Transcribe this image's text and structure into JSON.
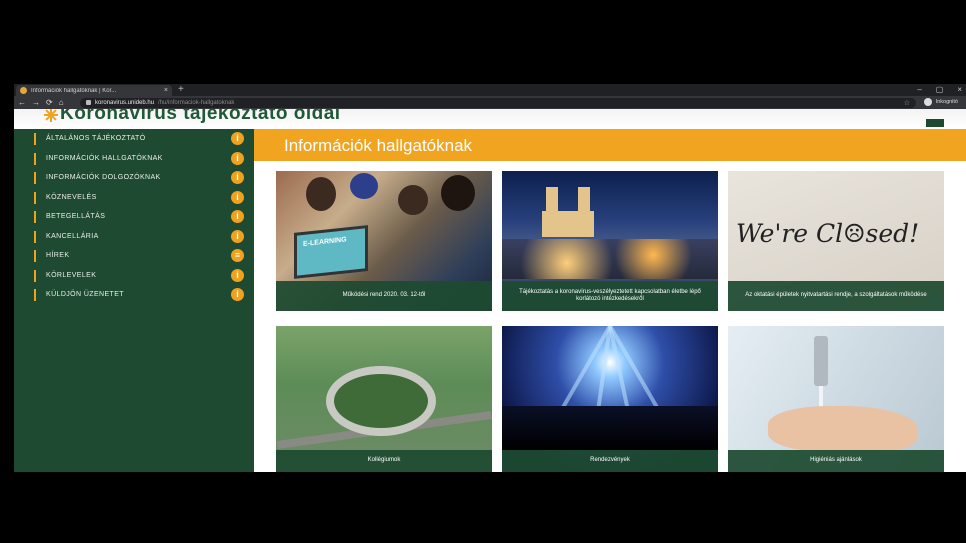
{
  "browser": {
    "tab_title": "Információk hallgatóknak | Kor...",
    "tab_close": "×",
    "new_tab": "+",
    "window_controls": [
      "–",
      "▢",
      "×"
    ],
    "nav_icons": [
      "←",
      "→",
      "⟳",
      "⌂"
    ],
    "url_host": "koronavirus.unideb.hu",
    "url_path": "/hu/informaciok-hallgatoknak",
    "profile_label": "Inkognitó"
  },
  "site": {
    "title": "Koronavírus tájékoztató oldal"
  },
  "sidebar": {
    "items": [
      {
        "label": "Általános tájékoztató",
        "badge": "i"
      },
      {
        "label": "Információk hallgatóknak",
        "badge": "i"
      },
      {
        "label": "Információk dolgozóknak",
        "badge": "i"
      },
      {
        "label": "Köznevelés",
        "badge": "i"
      },
      {
        "label": "Betegellátás",
        "badge": "i"
      },
      {
        "label": "Kancellária",
        "badge": "i"
      },
      {
        "label": "Hírek",
        "badge": "≡"
      },
      {
        "label": "Körlevelek",
        "badge": "i"
      },
      {
        "label": "Küldjön üzenetet",
        "badge": "i"
      }
    ]
  },
  "main": {
    "heading": "Információk hallgatóknak",
    "cards": [
      {
        "caption": "Működési rend 2020. 03. 12-től"
      },
      {
        "caption": "Tájékoztatás a koronavírus-veszélyeztetett kapcsolatban életbe lépő korlátozó intézkedésekről"
      },
      {
        "caption": "Az oktatási épületek nyitvatartási rendje, a szolgáltatások működése"
      },
      {
        "caption": "Kollégiumok"
      },
      {
        "caption": "Rendezvények"
      },
      {
        "caption": "Higiéniás ajánlások"
      }
    ],
    "laptop_text": "E-LEARNING",
    "closed_sign": "We're Cl☹sed!"
  },
  "colors": {
    "accent": "#f0a420",
    "sidebar": "#1d4a30"
  }
}
